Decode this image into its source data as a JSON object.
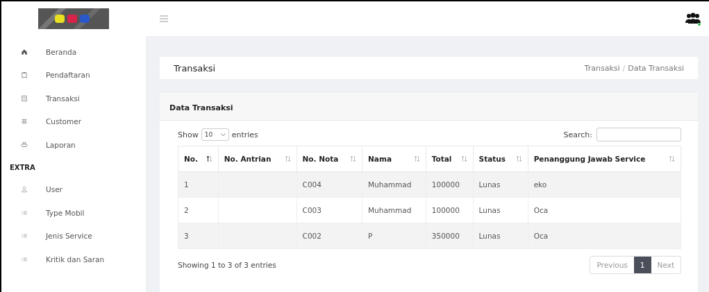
{
  "sidebar": {
    "items": [
      {
        "label": "Beranda"
      },
      {
        "label": "Pendaftaran"
      },
      {
        "label": "Transaksi"
      },
      {
        "label": "Customer"
      },
      {
        "label": "Laporan"
      }
    ],
    "section": "EXTRA",
    "extra_items": [
      {
        "label": "User"
      },
      {
        "label": "Type Mobil"
      },
      {
        "label": "Jenis Service"
      },
      {
        "label": "Kritik dan Saran"
      }
    ]
  },
  "page_header": {
    "title": "Transaksi",
    "breadcrumb": [
      "Transaksi",
      "Data Transaksi"
    ],
    "breadcrumb_separator": "/"
  },
  "card": {
    "title": "Data Transaksi",
    "show_label": "Show",
    "page_length": "10",
    "entries_label": "entries",
    "search_label": "Search:",
    "table": {
      "columns": [
        {
          "label": "No.",
          "sorted": true
        },
        {
          "label": "No. Antrian",
          "sorted": false
        },
        {
          "label": "No. Nota",
          "sorted": false
        },
        {
          "label": "Nama",
          "sorted": false
        },
        {
          "label": "Total",
          "sorted": false
        },
        {
          "label": "Status",
          "sorted": false
        },
        {
          "label": "Penanggung Jawab Service",
          "sorted": false
        }
      ],
      "rows": [
        [
          "1",
          "",
          "C004",
          "Muhammad",
          "100000",
          "Lunas",
          "eko"
        ],
        [
          "2",
          "",
          "C003",
          "Muhammad",
          "100000",
          "Lunas",
          "Oca"
        ],
        [
          "3",
          "",
          "C002",
          "P",
          "350000",
          "Lunas",
          "Oca"
        ]
      ]
    },
    "info": "Showing 1 to 3 of 3 entries",
    "pagination": [
      {
        "label": "Previous",
        "selected": false
      },
      {
        "label": "1",
        "selected": true
      },
      {
        "label": "Next",
        "selected": false
      }
    ]
  }
}
